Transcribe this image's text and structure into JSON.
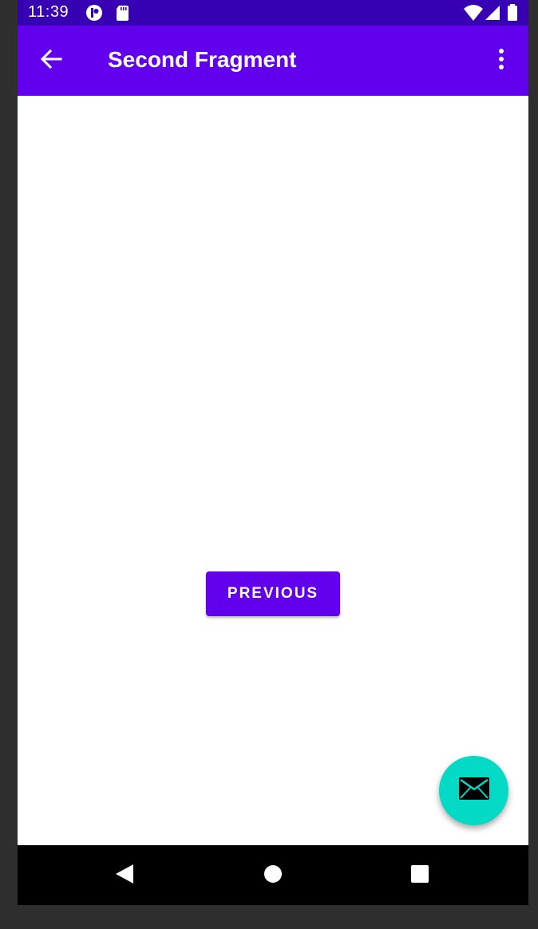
{
  "status_bar": {
    "time": "11:39",
    "icons": [
      "notification-icon",
      "sd-card-icon",
      "wifi-icon",
      "signal-icon",
      "battery-icon"
    ]
  },
  "app_bar": {
    "title": "Second Fragment",
    "back_icon": "arrow-back-icon",
    "menu_icon": "more-vert-icon"
  },
  "content": {
    "previous_button_label": "PREVIOUS"
  },
  "fab": {
    "icon": "email-icon"
  },
  "nav_bar": {
    "icons": [
      "back-triangle-icon",
      "home-circle-icon",
      "recents-square-icon"
    ]
  },
  "colors": {
    "status_bar": "#3700b3",
    "primary": "#6200ee",
    "accent": "#03dac5",
    "nav_bar": "#000000",
    "background": "#ffffff"
  }
}
